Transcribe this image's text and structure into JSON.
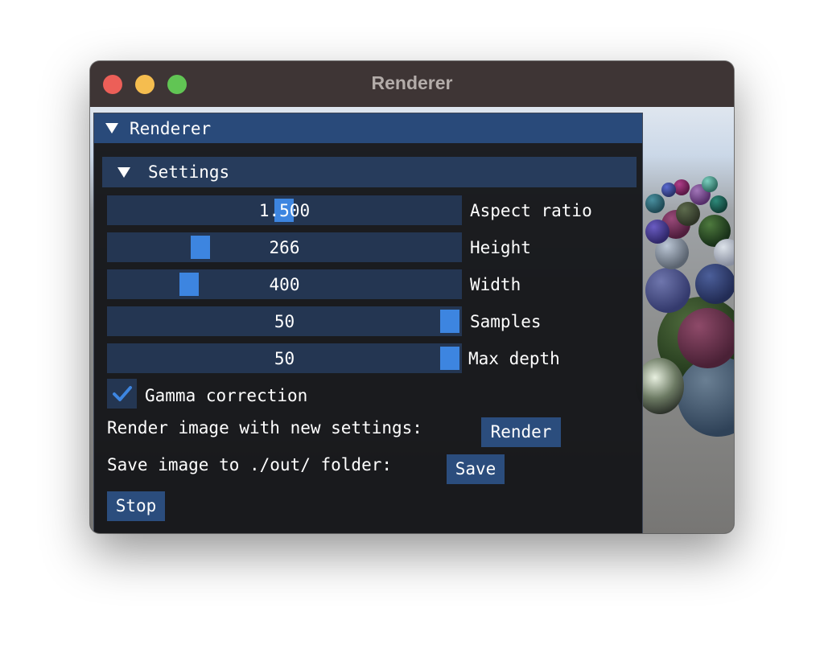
{
  "window": {
    "title": "Renderer"
  },
  "panel": {
    "title": "Renderer"
  },
  "settings": {
    "title": "Settings",
    "sliders": [
      {
        "label": "Aspect ratio",
        "value": "1.500",
        "fraction": 0.5
      },
      {
        "label": "Height",
        "value": "266",
        "fraction": 0.26
      },
      {
        "label": "Width",
        "value": "400",
        "fraction": 0.23
      },
      {
        "label": "Samples",
        "value": "50",
        "fraction": 1.0
      },
      {
        "label": "Max depth",
        "value": "50",
        "fraction": 1.0
      }
    ],
    "gamma": {
      "label": "Gamma correction",
      "checked": true
    }
  },
  "actions": {
    "render_text": "Render image with new settings:",
    "render_button": "Render",
    "save_text": "Save image to ./out/ folder:",
    "save_button": "Save",
    "stop_button": "Stop"
  },
  "colors": {
    "accent": "#3d85e0",
    "panel_header": "#294a7a",
    "section_header": "#273c5c",
    "frame": "#243652",
    "button": "#2b4d7d"
  },
  "icons": [
    "collapse-arrow-icon",
    "checkmark-icon"
  ]
}
